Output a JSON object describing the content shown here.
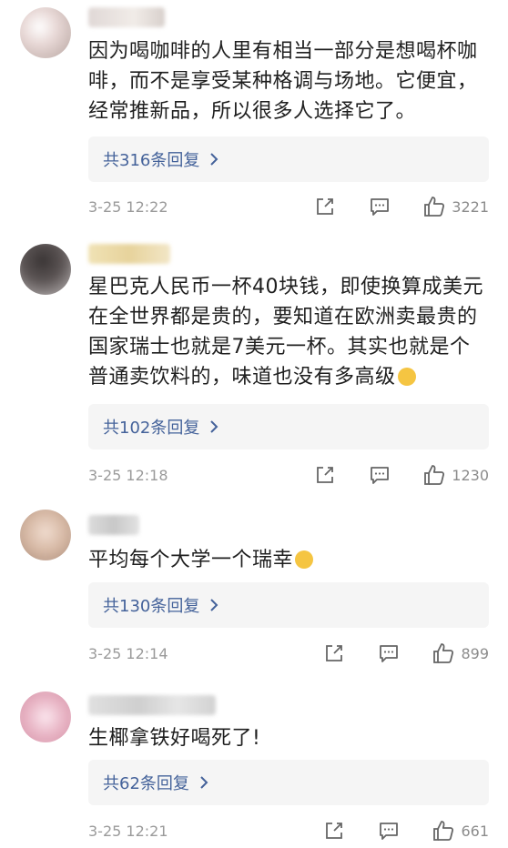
{
  "comments": [
    {
      "text": "因为喝咖啡的人里有相当一部分是想喝杯咖啡，而不是享受某种格调与场地。它便宜，经常推新品，所以很多人选择它了。",
      "replies": "共316条回复",
      "time": "3-25 12:22",
      "likes": "3221",
      "avatar_color": "#c9b8b4",
      "name_color": "#d8d0cc",
      "has_emoji": false
    },
    {
      "text": "星巴克人民币一杯40块钱，即使换算成美元在全世界都是贵的，要知道在欧洲卖最贵的国家瑞士也就是7美元一杯。其实也就是个普通卖饮料的，味道也没有多高级",
      "replies": "共102条回复",
      "time": "3-25 12:18",
      "likes": "1230",
      "avatar_color": "#6b6464",
      "name_color": "#e7d39c",
      "has_emoji": true
    },
    {
      "text": "平均每个大学一个瑞幸",
      "replies": "共130条回复",
      "time": "3-25 12:14",
      "likes": "899",
      "avatar_color": "#d6b8a4",
      "name_color": "#d4d4d4",
      "has_emoji": true
    },
    {
      "text": "生椰拿铁好喝死了!",
      "replies": "共62条回复",
      "time": "3-25 12:21",
      "likes": "661",
      "avatar_color": "#e8b4c4",
      "name_color": "#d6d6d6",
      "has_emoji": false
    }
  ],
  "icons": {
    "share": "share-icon",
    "comment": "comment-icon",
    "like": "thumbs-up-icon",
    "reply_chevron": "chevron-right-icon"
  },
  "colors": {
    "reply_link": "#44629a",
    "reply_bg": "#f5f5f5",
    "meta_text": "#9a9a9a"
  }
}
